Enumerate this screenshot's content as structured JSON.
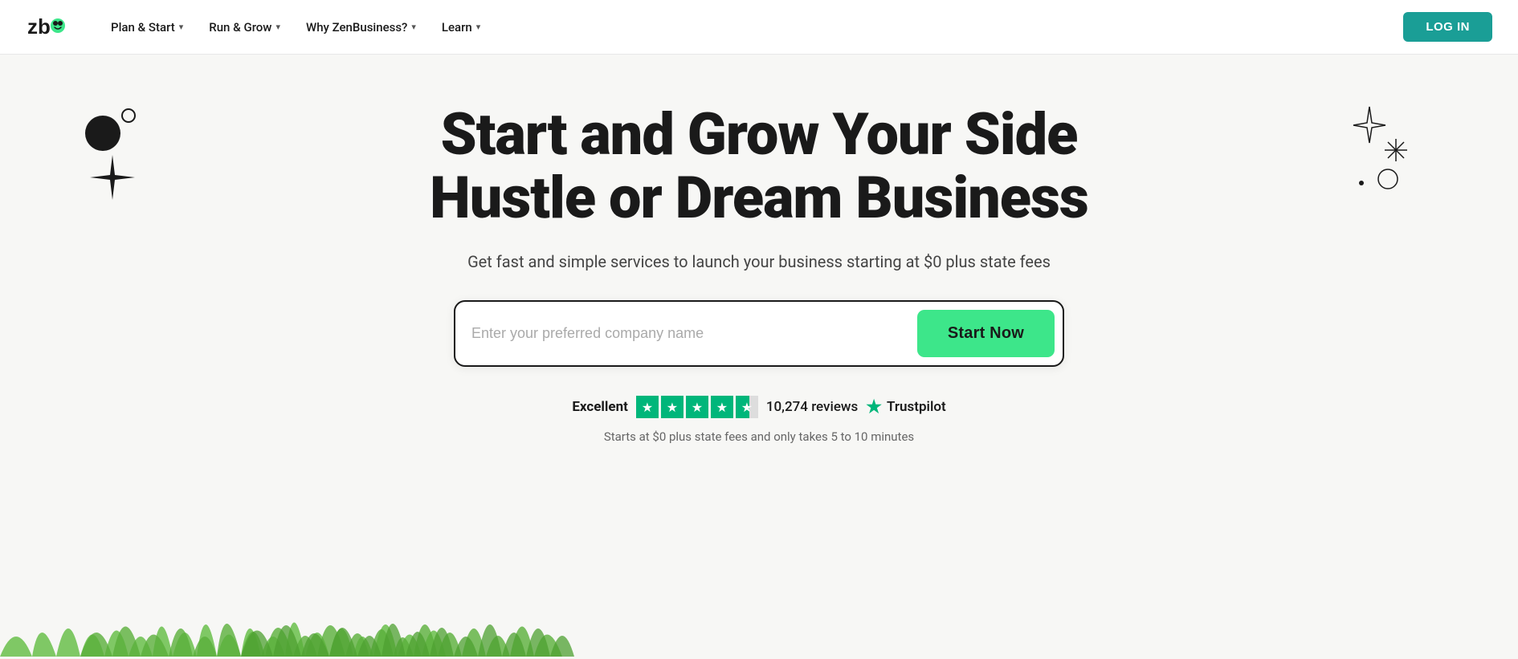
{
  "nav": {
    "logo_alt": "ZenBusiness",
    "links": [
      {
        "label": "Plan & Start",
        "has_dropdown": true
      },
      {
        "label": "Run & Grow",
        "has_dropdown": true
      },
      {
        "label": "Why ZenBusiness?",
        "has_dropdown": true
      },
      {
        "label": "Learn",
        "has_dropdown": true
      }
    ],
    "login_label": "LOG IN"
  },
  "hero": {
    "title_line1": "Start and Grow Your Side",
    "title_line2": "Hustle or Dream Business",
    "subtitle": "Get fast and simple services to launch your business starting at $0 plus state fees",
    "search_placeholder": "Enter your preferred company name",
    "cta_label": "Start Now",
    "trustpilot": {
      "excellent_label": "Excellent",
      "reviews_count": "10,274 reviews",
      "brand_label": "Trustpilot"
    },
    "footnote": "Starts at $0 plus state fees and only takes 5 to 10 minutes"
  },
  "colors": {
    "primary_teal": "#1a9e96",
    "cta_green": "#3de68a",
    "trustpilot_green": "#00b67a"
  }
}
